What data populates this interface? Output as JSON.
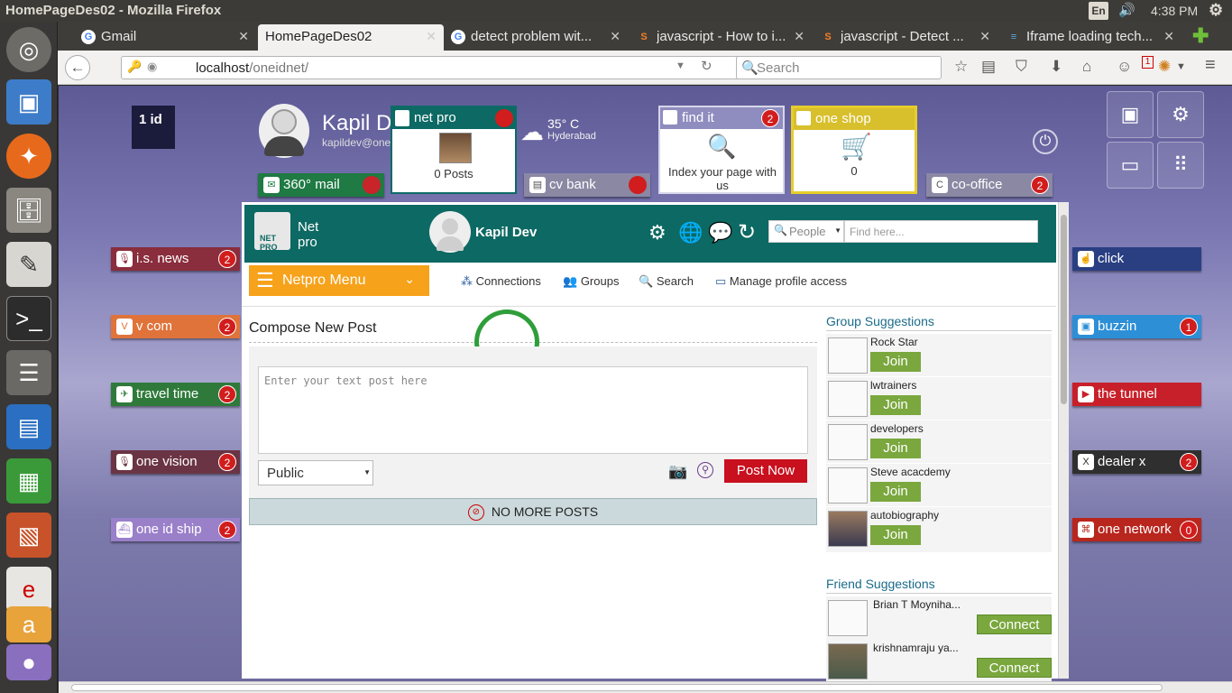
{
  "os_bar": {
    "title": "HomePageDes02 - Mozilla Firefox",
    "lang": "En",
    "clock": "4:38 PM"
  },
  "tabs": [
    {
      "label": "Gmail",
      "favicon": "G"
    },
    {
      "label": "HomePageDes02",
      "favicon": ""
    },
    {
      "label": "detect problem wit...",
      "favicon": "G"
    },
    {
      "label": "javascript - How to i...",
      "favicon": "S"
    },
    {
      "label": "javascript - Detect ...",
      "favicon": "S"
    },
    {
      "label": "Iframe loading tech...",
      "favicon": "≡"
    }
  ],
  "navbar": {
    "url_host": "localhost",
    "url_path": "/oneidnet/",
    "search_placeholder": "Search",
    "notif_count": "1"
  },
  "header": {
    "logo_text": "1 id",
    "user_name": "Kapil D",
    "user_email": "kapildev@one",
    "weather_temp": "35° C",
    "weather_city": "Hyderabad"
  },
  "tiles": {
    "netpro": {
      "title": "net pro",
      "caption": "0 Posts"
    },
    "findit": {
      "title": "find it",
      "badge": "2",
      "caption": "Index your page with us"
    },
    "oneshop": {
      "title": "one shop",
      "caption": "0"
    },
    "mail": {
      "title": "360° mail"
    },
    "cvbank": {
      "title": "cv bank"
    },
    "cooffice": {
      "title": "co-office",
      "badge": "2"
    }
  },
  "left_apps": [
    {
      "label": "i.s. news",
      "badge": "2",
      "color": "#8a2d3c"
    },
    {
      "label": "v com",
      "badge": "2",
      "color": "#e0733a"
    },
    {
      "label": "travel time",
      "badge": "2",
      "color": "#2f7a3b"
    },
    {
      "label": "one vision",
      "badge": "2",
      "color": "#6a3444"
    },
    {
      "label": "one id ship",
      "badge": "2",
      "color": "#9a7fc9"
    }
  ],
  "right_apps": [
    {
      "label": "click",
      "badge": "",
      "color": "#2a3f82"
    },
    {
      "label": "buzzin",
      "badge": "1",
      "color": "#2d8fd6"
    },
    {
      "label": "the tunnel",
      "badge": "",
      "color": "#c8202a"
    },
    {
      "label": "dealer x",
      "badge": "2",
      "color": "#2f2f2f"
    },
    {
      "label": "one network",
      "badge": "0",
      "color": "#b8261e"
    }
  ],
  "netpro": {
    "brand_line1": "Net",
    "brand_line2": "pro",
    "user": "Kapil Dev",
    "people_select": "People",
    "find_placeholder": "Find here...",
    "menu_label": "Netpro Menu",
    "nav": [
      "Connections",
      "Groups",
      "Search",
      "Manage profile access"
    ],
    "compose_title": "Compose New Post",
    "post_placeholder": "Enter your text post here",
    "visibility": "Public",
    "post_button": "Post Now",
    "no_more": "NO MORE POSTS",
    "group_title": "Group Suggestions",
    "groups": [
      "Rock Star",
      "lwtrainers",
      "developers",
      "Steve acacdemy",
      "autobiography"
    ],
    "join_label": "Join",
    "friend_title": "Friend Suggestions",
    "friends": [
      "Brian T Moyniha...",
      "krishnamraju ya..."
    ],
    "connect_label": "Connect"
  },
  "colors": {
    "teal": "#0d6963",
    "orange": "#f7a21b",
    "green_btn": "#7aa73e",
    "red_btn": "#c8101e"
  }
}
